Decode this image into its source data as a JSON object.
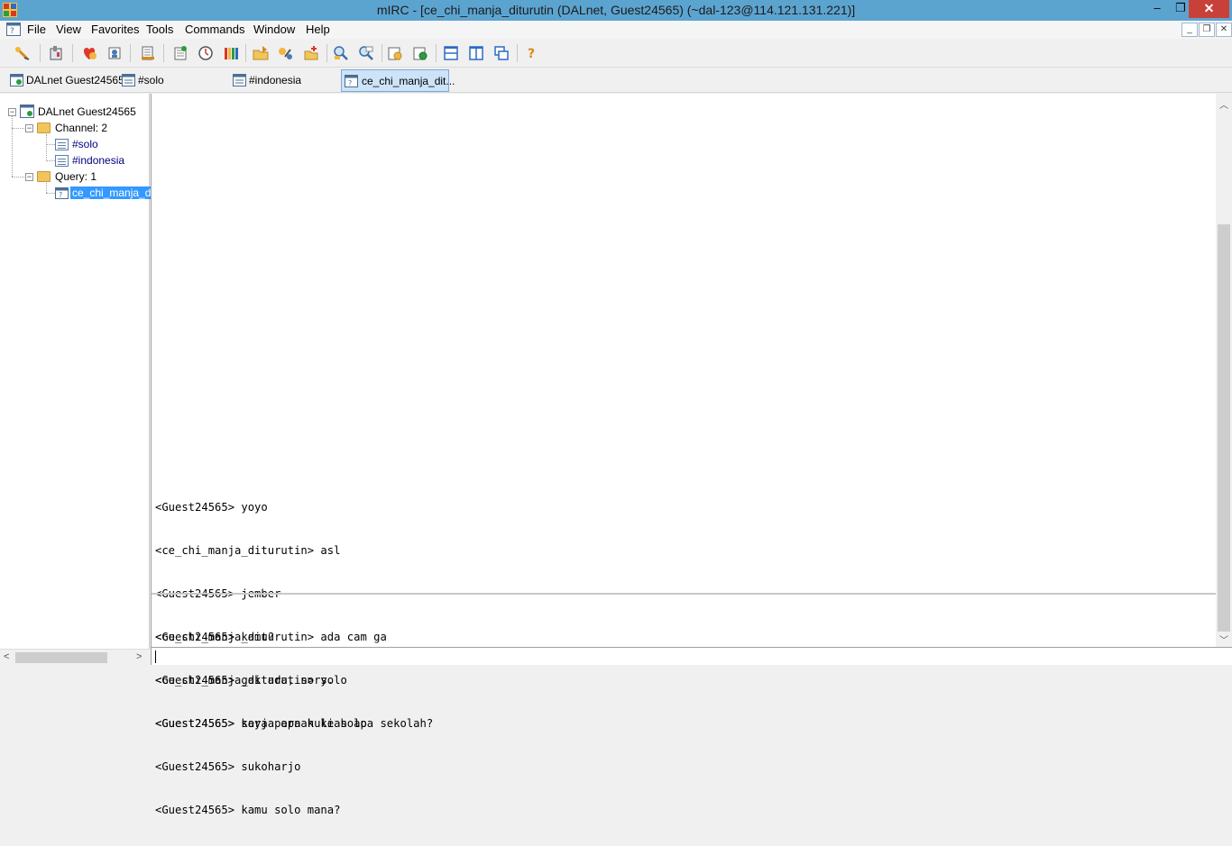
{
  "window": {
    "title": "mIRC - [ce_chi_manja_diturutin (DALnet, Guest24565) (~dal-123@114.121.131.221)]",
    "minimize": "–",
    "maximize": "❐",
    "close": "✕"
  },
  "menu": {
    "items": [
      "File",
      "View",
      "Favorites",
      "Tools",
      "Commands",
      "Window",
      "Help"
    ],
    "mdi_minimize": "_",
    "mdi_restore": "❐",
    "mdi_close": "✕"
  },
  "toolbar": {
    "buttons": [
      "connect-icon",
      "options-icon",
      "favorites-icon",
      "address-book-icon",
      "log-icon",
      "notify-icon",
      "timer-icon",
      "colors-icon",
      "send-file-icon",
      "chat-icon",
      "dcc-icon",
      "channels-list-icon",
      "url-list-icon",
      "received-files-icon",
      "scripts-icon",
      "tile-horizontal-icon",
      "tile-vertical-icon",
      "cascade-icon",
      "help-icon"
    ]
  },
  "switchbar": {
    "tabs": [
      {
        "label": "DALnet Guest24565",
        "active": false
      },
      {
        "label": "#solo",
        "active": false
      },
      {
        "label": "#indonesia",
        "active": false
      },
      {
        "label": "ce_chi_manja_dit...",
        "active": true
      }
    ]
  },
  "tree": {
    "server": "DALnet Guest24565",
    "channel_folder": "Channel: 2",
    "channels": [
      "#solo",
      "#indonesia"
    ],
    "query_folder": "Query: 1",
    "queries": [
      "ce_chi_manja_d"
    ],
    "expander_minus": "−"
  },
  "scroll": {
    "left": "<",
    "right": ">",
    "up": "︿",
    "down": "﹀"
  },
  "chat": {
    "lines_before_marker": [
      "<Guest24565> yoyo",
      "<ce_chi_manja_diturutin> asl",
      "<Guest24565> jember",
      "<Guest24565> kamu?",
      "<ce_chi_manja_diturutin> solo",
      "<Guest24565> saya pernah ke solo",
      "<Guest24565> sukoharjo",
      "<Guest24565> kamu solo mana?"
    ],
    "lines_after_marker": [
      "<ce_chi_manja_diturutin> ada cam ga",
      "<Guest24565> gak ada, sory.",
      "<Guest24565> kerja apa kuliah apa sekolah?"
    ]
  },
  "editbox": {
    "value": ""
  }
}
